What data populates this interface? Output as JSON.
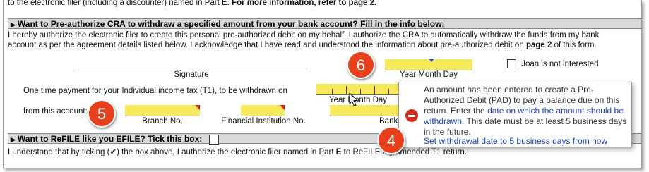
{
  "top_text": {
    "normal": "to the electronic filer (including a discounter) named in Part E.",
    "bold": "For more information, refer to page 2."
  },
  "section1": {
    "title": "Want to Pre-authorize CRA to withdraw a specified amount from your bank account? Fill in the info below:",
    "para1": "I hereby authorize the electronic filer to create this personal pre-authorized debit on my behalf. I authorize the CRA to automatically withdraw the funds from my bank",
    "para2_a": "account as per the agreement details listed below. I acknowledge that I have read and understood the information about pre-authorized debit on",
    "para2_b": "page 2",
    "para2_c": "of this form.",
    "signature_label": "Signature",
    "date_label": "Year Month Day",
    "joan_label": "Joan is not interested",
    "one_time_label": "One time payment for your Individual income tax (T1), to be withdrawn on",
    "withdraw_date_label": "Year  Month Day",
    "from_account_label": "from this account:",
    "branch_label": "Branch No.",
    "institution_label": "Financial Institution No.",
    "bank_label": "Bank"
  },
  "section2": {
    "title": "Want to ReFILE like you EFILE? Tick this box:",
    "para_a": "I understand that by ticking (",
    "check_glyph": "✔",
    "para_b": ") the box above, I authorize the electronic filer named in Part",
    "para_bold": "E",
    "para_c": "to ReFILE my amended T1 return."
  },
  "tooltip": {
    "msg1": "An amount has been entered to create a Pre-Authorized Debit (PAD) to pay a balance due on this return. Enter the",
    "msg_link": "date on which the amount should be withdrawn",
    "msg2": ". This date must be at least 5 business days in the future.",
    "action": "Set withdrawal date to 5 business days from now"
  },
  "badges": {
    "b6": "6",
    "b5": "5",
    "b4": "4"
  },
  "colors": {
    "field_yellow": "#f6ea5a",
    "badge": "#e8401c",
    "link": "#1a3fbf",
    "error": "#d42a1e",
    "header": "#d9d9d9"
  }
}
